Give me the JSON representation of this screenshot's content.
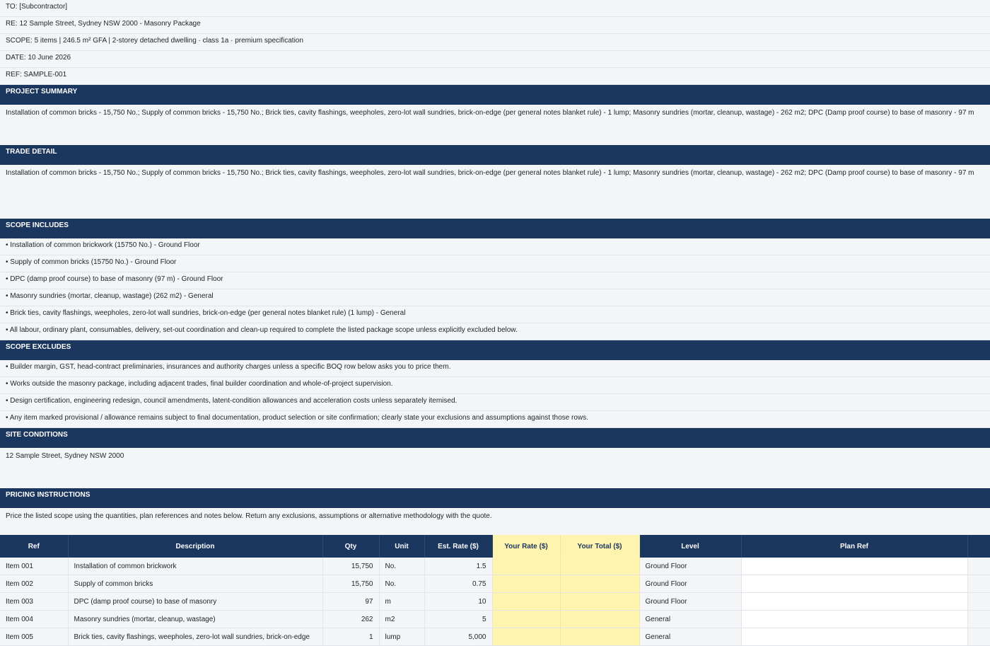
{
  "header": {
    "to": "TO: [Subcontractor]",
    "re": "RE: 12 Sample Street, Sydney NSW 2000 - Masonry Package",
    "scope": "SCOPE: 5 items | 246.5 m² GFA | 2-storey detached dwelling · class 1a · premium specification",
    "date": "DATE: 10 June 2026",
    "ref": "REF: SAMPLE-001"
  },
  "project_summary": {
    "title": "PROJECT SUMMARY",
    "text": "Installation of common bricks - 15,750 No.; Supply of common bricks - 15,750 No.; Brick ties, cavity flashings, weepholes, zero-lot wall sundries, brick-on-edge (per general notes blanket rule) - 1 lump; Masonry sundries (mortar, cleanup, wastage) - 262 m2; DPC (Damp proof course) to base of masonry - 97 m"
  },
  "trade_detail": {
    "title": "TRADE DETAIL",
    "text": "Installation of common bricks - 15,750 No.; Supply of common bricks - 15,750 No.; Brick ties, cavity flashings, weepholes, zero-lot wall sundries, brick-on-edge (per general notes blanket rule) - 1 lump; Masonry sundries (mortar, cleanup, wastage) - 262 m2; DPC (Damp proof course) to base of masonry - 97 m"
  },
  "scope_includes": {
    "title": "SCOPE INCLUDES",
    "items": [
      "• Installation of common brickwork (15750 No.) - Ground Floor",
      "• Supply of common bricks (15750 No.) - Ground Floor",
      "• DPC (damp proof course) to base of masonry (97 m) - Ground Floor",
      "• Masonry sundries (mortar, cleanup, wastage) (262 m2) - General",
      "• Brick ties, cavity flashings, weepholes, zero-lot wall sundries, brick-on-edge (per general notes blanket rule) (1 lump) - General",
      "• All labour, ordinary plant, consumables, delivery, set-out coordination and clean-up required to complete the listed package scope unless explicitly excluded below."
    ]
  },
  "scope_excludes": {
    "title": "SCOPE EXCLUDES",
    "items": [
      "• Builder margin, GST, head-contract preliminaries, insurances and authority charges unless a specific BOQ row below asks you to price them.",
      "• Works outside the masonry package, including adjacent trades, final builder coordination and whole-of-project supervision.",
      "• Design certification, engineering redesign, council amendments, latent-condition allowances and acceleration costs unless separately itemised.",
      "• Any item marked provisional / allowance remains subject to final documentation, product selection or site confirmation; clearly state your exclusions and assumptions against those rows."
    ]
  },
  "site_conditions": {
    "title": "SITE CONDITIONS",
    "text": "12 Sample Street, Sydney NSW 2000"
  },
  "pricing_instructions": {
    "title": "PRICING INSTRUCTIONS",
    "text": "Price the listed scope using the quantities, plan references and notes below. Return any exclusions, assumptions or alternative methodology with the quote."
  },
  "table": {
    "columns": [
      "Ref",
      "Description",
      "Qty",
      "Unit",
      "Est. Rate ($)",
      "Your Rate ($)",
      "Your Total ($)",
      "Level",
      "Plan Ref"
    ],
    "rows": [
      {
        "ref": "Item 001",
        "desc": "Installation of common brickwork",
        "qty": "15,750",
        "unit": "No.",
        "rate": "1.5",
        "your_rate": "",
        "your_total": "",
        "level": "Ground Floor",
        "plan_ref": ""
      },
      {
        "ref": "Item 002",
        "desc": "Supply of common bricks",
        "qty": "15,750",
        "unit": "No.",
        "rate": "0.75",
        "your_rate": "",
        "your_total": "",
        "level": "Ground Floor",
        "plan_ref": ""
      },
      {
        "ref": "Item 003",
        "desc": "DPC (damp proof course) to base of masonry",
        "qty": "97",
        "unit": "m",
        "rate": "10",
        "your_rate": "",
        "your_total": "",
        "level": "Ground Floor",
        "plan_ref": ""
      },
      {
        "ref": "Item 004",
        "desc": "Masonry sundries (mortar, cleanup, wastage)",
        "qty": "262",
        "unit": "m2",
        "rate": "5",
        "your_rate": "",
        "your_total": "",
        "level": "General",
        "plan_ref": ""
      },
      {
        "ref": "Item 005",
        "desc": "Brick ties, cavity flashings, weepholes, zero-lot wall sundries, brick-on-edge",
        "qty": "1",
        "unit": "lump",
        "rate": "5,000",
        "your_rate": "",
        "your_total": "",
        "level": "General",
        "plan_ref": ""
      }
    ]
  },
  "colors": {
    "header_bg": "#1b365f",
    "input_cell": "#fff3b0",
    "page_bg": "#f3f5f7"
  }
}
